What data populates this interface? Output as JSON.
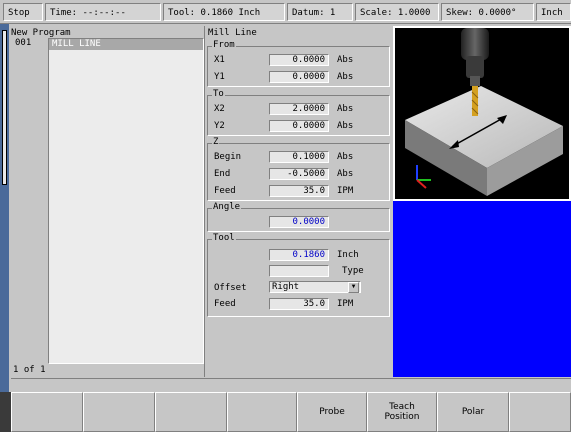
{
  "status_bar": {
    "mode": "Stop",
    "time": "Time:  --:--:--",
    "tool": "Tool: 0.1860  Inch",
    "datum": "Datum: 1",
    "scale": "Scale: 1.0000",
    "skew": "Skew: 0.0000°",
    "units": "Inch"
  },
  "program": {
    "title": "New Program",
    "rows": [
      {
        "num": "001",
        "name": "MILL LINE"
      }
    ],
    "page_count": "1 of 1"
  },
  "form": {
    "title": "Mill Line",
    "from": {
      "legend": "From",
      "x1_label": "X1",
      "x1": "0.0000",
      "x1_unit": "Abs",
      "y1_label": "Y1",
      "y1": "0.0000",
      "y1_unit": "Abs"
    },
    "to": {
      "legend": "To",
      "x2_label": "X2",
      "x2": "2.0000",
      "x2_unit": "Abs",
      "y2_label": "Y2",
      "y2": "0.0000",
      "y2_unit": "Abs"
    },
    "z": {
      "legend": "Z",
      "begin_label": "Begin",
      "begin": "0.1000",
      "begin_unit": "Abs",
      "end_label": "End",
      "end": "-0.5000",
      "end_unit": "Abs",
      "feed_label": "Feed",
      "feed": "35.0",
      "feed_unit": "IPM"
    },
    "angle": {
      "legend": "Angle",
      "value": "0.0000"
    },
    "tool": {
      "legend": "Tool",
      "diameter": "0.1860",
      "diameter_unit": "Inch",
      "type": "",
      "type_label": "Type",
      "offset_label": "Offset",
      "offset": "Right",
      "feed_label": "Feed",
      "feed": "35.0",
      "feed_unit": "IPM"
    }
  },
  "softkeys": [
    "",
    "",
    "",
    "",
    "Probe",
    "Teach Position",
    "Polar",
    ""
  ],
  "colors": {
    "panel": "#c6c6c6",
    "list_bg": "#ececec",
    "active_value": "#0000c8",
    "viewport_bg": "#000000",
    "blue_area": "#0000ff"
  }
}
